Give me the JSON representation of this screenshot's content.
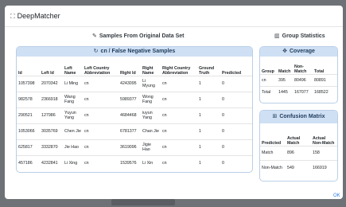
{
  "modal": {
    "title": "DeepMatcher",
    "title_icon": "expand-icon",
    "ok_label": "OK"
  },
  "samples": {
    "heading": "Samples From Original Data Set",
    "heading_icon": "wrench-icon",
    "table_title": "cn / False Negative Samples",
    "table_icon": "refresh-icon",
    "columns": [
      "Id",
      "Left Id",
      "Left Name",
      "Left Country Abbreviation",
      "Right Id",
      "Right Name",
      "Right Country Abbreviation",
      "Ground Truth",
      "Predicted"
    ],
    "rows": [
      [
        "1057398",
        "2070342",
        "Li Ming",
        "cn",
        "4243095",
        "Li Myung",
        "cn",
        "1",
        "0"
      ],
      [
        "982578",
        "2366918",
        "Wang Fang",
        "cn",
        "5989377",
        "Wong Fang",
        "cn",
        "1",
        "0"
      ],
      [
        "290521",
        "127986",
        "Yuyun Yang",
        "cn",
        "4684468",
        "iuyun Yang",
        "cn",
        "1",
        "0"
      ],
      [
        "1053066",
        "3035769",
        "Chen Jie",
        "cn",
        "6781377",
        "Chan Jie",
        "cn",
        "1",
        "0"
      ],
      [
        "625817",
        "3332870",
        "Jie Hao",
        "cn",
        "3619096",
        "Jigie Hao",
        "cn",
        "1",
        "0"
      ],
      [
        "457186",
        "4232841",
        "Li Xing",
        "cn",
        "1539576",
        "Li Xin",
        "cn",
        "1",
        "0"
      ]
    ]
  },
  "stats": {
    "heading": "Group Statistics",
    "heading_icon": "bar-chart-icon",
    "coverage": {
      "title": "Coverage",
      "icon": "puzzle-icon",
      "columns": [
        "Group",
        "Match",
        "Non-Match",
        "Total"
      ],
      "rows": [
        [
          "cn",
          "395",
          "80496",
          "80891"
        ],
        [
          "Total",
          "1445",
          "167077",
          "168522"
        ]
      ]
    },
    "confusion": {
      "title": "Confusion Matrix",
      "icon": "grid-icon",
      "columns": [
        "Predicted",
        "Actual Match",
        "Actual Non-Match"
      ],
      "rows": [
        [
          "Match",
          "896",
          "158"
        ],
        [
          "Non-Match",
          "549",
          "166919"
        ]
      ]
    }
  },
  "colors": {
    "card_header_bg": "#cfe0f4",
    "card_border": "#b9cfe6",
    "ok_link": "#2f7de1"
  }
}
